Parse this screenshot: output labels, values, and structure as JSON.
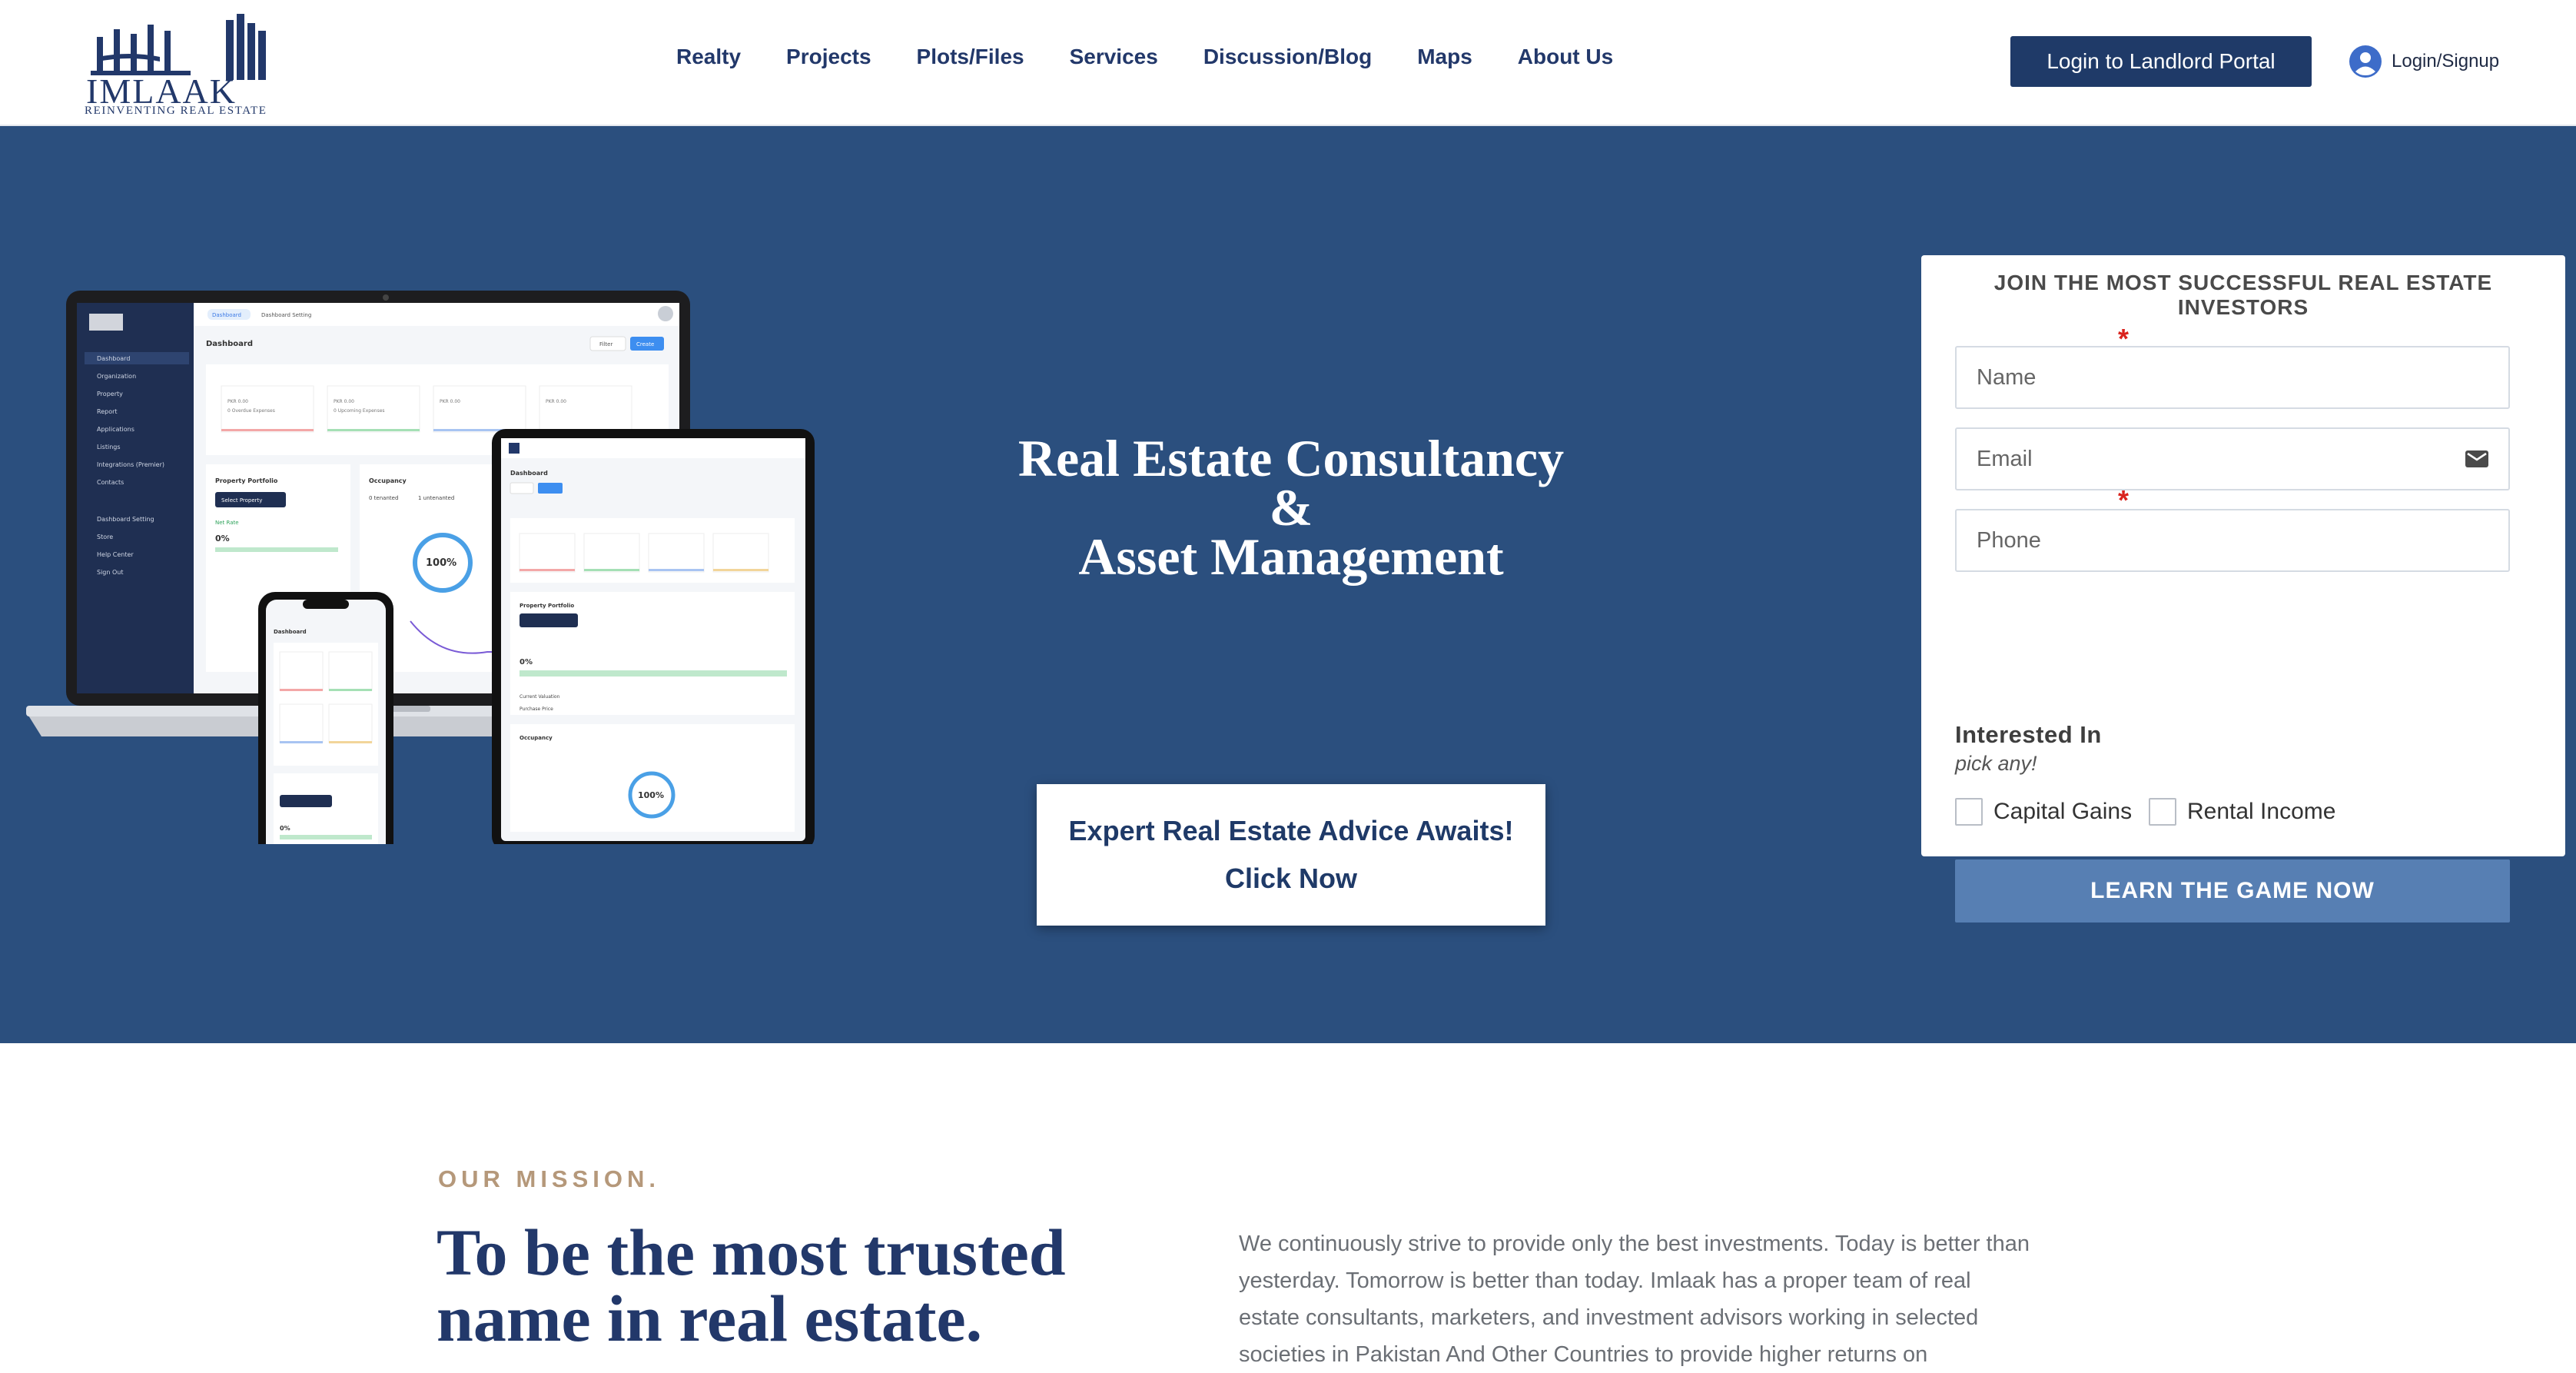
{
  "brand": {
    "name": "IMLAAK",
    "tagline": "REINVENTING REAL ESTATE"
  },
  "nav": {
    "items": [
      "Realty",
      "Projects",
      "Plots/Files",
      "Services",
      "Discussion/Blog",
      "Maps",
      "About Us"
    ]
  },
  "header": {
    "landlord_label": "Login to Landlord Portal",
    "login_label": "Login/Signup"
  },
  "hero": {
    "title_line1": "Real Estate Consultancy",
    "title_line2": "&",
    "title_line3": "Asset Management",
    "cta_line1": "Expert Real Estate Advice Awaits!",
    "cta_line2": "Click Now"
  },
  "form": {
    "title": "JOIN THE MOST SUCCESSFUL REAL ESTATE INVESTORS",
    "name_placeholder": "Name",
    "email_placeholder": "Email",
    "phone_placeholder": "Phone",
    "required_mark": "*",
    "interest_title": "Interested In",
    "interest_sub": "pick any!",
    "options": [
      "Capital Gains",
      "Rental Income"
    ],
    "submit_label": "LEARN THE GAME NOW"
  },
  "mission": {
    "label": "OUR MISSION.",
    "heading_line1": "To be the most trusted",
    "heading_line2": "name in real estate.",
    "body_lines": [
      "We continuously strive to provide only the best investments. Today is better than",
      "yesterday. Tomorrow is better than today. Imlaak has a proper team of real",
      "estate consultants, marketers, and investment advisors working in selected",
      "societies in Pakistan And Other Countries to provide higher returns on"
    ]
  },
  "mockup": {
    "dashboard_title": "Dashboard",
    "breadcrumb_1": "Dashboard",
    "breadcrumb_2": "Dashboard Setting",
    "filter_label": "Filter",
    "create_label": "Create",
    "portfolio_title": "Property Portfolio",
    "occupancy_title": "Occupancy",
    "select_property": "Select Property",
    "percent": "100%",
    "zero_percent": "0%",
    "tenanted": "0 tenanted",
    "untenanted": "1 untenanted",
    "net_rate": "Net Rate",
    "stat_value": "PKR 0.00",
    "stat_overdue": "0 Overdue Expenses",
    "stat_upcoming": "0 Upcoming Expenses",
    "sidebar_items": [
      "Dashboard",
      "Organization",
      "Property",
      "Report",
      "Applications",
      "Listings",
      "Integrations (Premier)",
      "Contacts",
      "Dashboard Setting",
      "Store",
      "Help Center",
      "Sign Out"
    ],
    "current_valuation": "Current Valuation",
    "purchase_price": "Purchase Price"
  },
  "colors": {
    "hero_bg": "#2b4f7e",
    "brand_navy": "#1f3a68",
    "submit_blue": "#577fb3",
    "mission_gold": "#b5987a",
    "required_red": "#d9231d"
  }
}
